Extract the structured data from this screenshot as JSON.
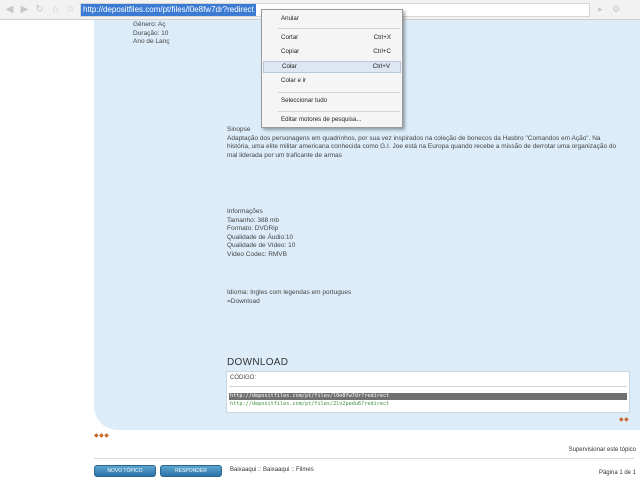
{
  "browser": {
    "url": "http://depositfiles.com/pt/files/l0e8fw7dr?redirect",
    "back_icon": "back-arrow-icon",
    "forward_icon": "forward-arrow-icon",
    "reload_icon": "reload-icon",
    "home_icon": "home-icon"
  },
  "context_menu": {
    "items": [
      {
        "label": "Anular",
        "shortcut": ""
      },
      {
        "label": "Cortar",
        "shortcut": "Ctrl+X"
      },
      {
        "label": "Copiar",
        "shortcut": "Ctrl+C"
      },
      {
        "label": "Colar",
        "shortcut": "Ctrl+V"
      },
      {
        "label": "Colar e ir",
        "shortcut": ""
      },
      {
        "label": "Seleccionar tudo",
        "shortcut": ""
      },
      {
        "label": "Editar motores de pesquisa...",
        "shortcut": ""
      }
    ]
  },
  "post": {
    "partial_lines": [
      "Gênero: Aç",
      "Duração: 10",
      "Ano de Lanç"
    ],
    "synopsis_title": "Sinopse",
    "synopsis_lines": [
      "Adaptação dos personagens em quadrinhos, por sua vez inspirados na coleção de bonecos da Hasbro \"Comandos em Ação\". Na",
      "história, uma elite militar americana conhecida como G.I. Joe está na Europa quando recebe a missão de derrotar uma organização do",
      "mal liderada por um traficante de armas"
    ],
    "info_title": "Informações",
    "info_lines": [
      "Tamanho: 388 mb",
      "Formato: DVDRip",
      "Qualidade de Áudio:10",
      "Qualidade de Vídeo: 10",
      "Vídeo Codec: RMVB"
    ],
    "language": "Idioma: Ingles com legendas em portugues",
    "download_link": "=Download",
    "download_heading": "DOWNLOAD",
    "code_label": "CÓDIGO:",
    "code_lines": [
      "http://depositfiles.com/pt/files/l0e8fw7dr?redirect",
      "http://depositfiles.com/pt/files/2lv2pedu6?redirect"
    ]
  },
  "footer": {
    "supervise": "Supervisionar este tópico",
    "new_topic_button": "NOVO TÓPICO",
    "reply_button": "RESPONDER",
    "breadcrumb": "Baixaaqui :: Baixaaqui :: Filmes",
    "page": "Página 1 de 1"
  }
}
